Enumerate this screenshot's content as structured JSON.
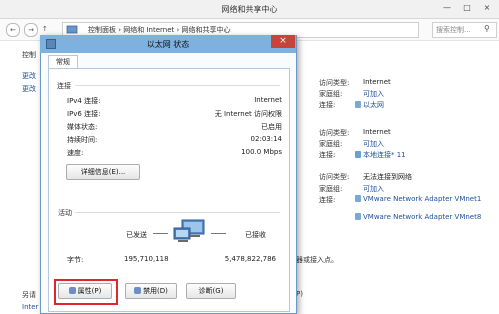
{
  "window": {
    "title": "网络和共享中心",
    "address_path": "控制面板  ›  网络和 Internet  ›  网络和共享中心",
    "search_placeholder": "搜索控制...",
    "minimize": "—",
    "maximize": "□",
    "close": "×"
  },
  "sidebar": {
    "items": [
      "控制",
      "更改",
      "更改"
    ],
    "bottom_a": "另请",
    "bottom_b": "Inter"
  },
  "right_panel": {
    "groups": [
      {
        "access_type_label": "访问类型:",
        "access_type": "Internet",
        "homegroup_label": "家庭组:",
        "homegroup": "可加入",
        "connections_label": "连接:",
        "connection": "以太网"
      },
      {
        "access_type_label": "访问类型:",
        "access_type": "Internet",
        "homegroup_label": "家庭组:",
        "homegroup": "可加入",
        "connections_label": "连接:",
        "connection": "本地连接* 11"
      },
      {
        "access_type_label": "访问类型:",
        "access_type": "无法连接到网络",
        "homegroup_label": "家庭组:",
        "homegroup": "可加入",
        "connections_label": "连接:",
        "connection_lines": [
          "VMware Network Adapter VMnet1",
          "VMware Network Adapter VMnet8"
        ]
      }
    ],
    "partial_1": "器或接入点。",
    "partial_2": "P)"
  },
  "dialog": {
    "title": "以太网 状态",
    "close": "×",
    "tab": "常规",
    "connection_section": "连接",
    "rows": [
      {
        "label": "IPv4 连接:",
        "value": "Internet"
      },
      {
        "label": "IPv6 连接:",
        "value": "无 Internet 访问权限"
      },
      {
        "label": "媒体状态:",
        "value": "已启用"
      },
      {
        "label": "持续时间:",
        "value": "02:03:14"
      },
      {
        "label": "速度:",
        "value": "100.0 Mbps"
      }
    ],
    "details_button": "详细信息(E)...",
    "activity_section": "活动",
    "sent_label": "已发送",
    "received_label": "已接收",
    "bytes_label": "字节:",
    "bytes_sent": "195,710,118",
    "bytes_received": "5,478,822,786",
    "properties_button": "属性(P)",
    "disable_button": "禁用(D)",
    "diagnose_button": "诊断(G)"
  }
}
